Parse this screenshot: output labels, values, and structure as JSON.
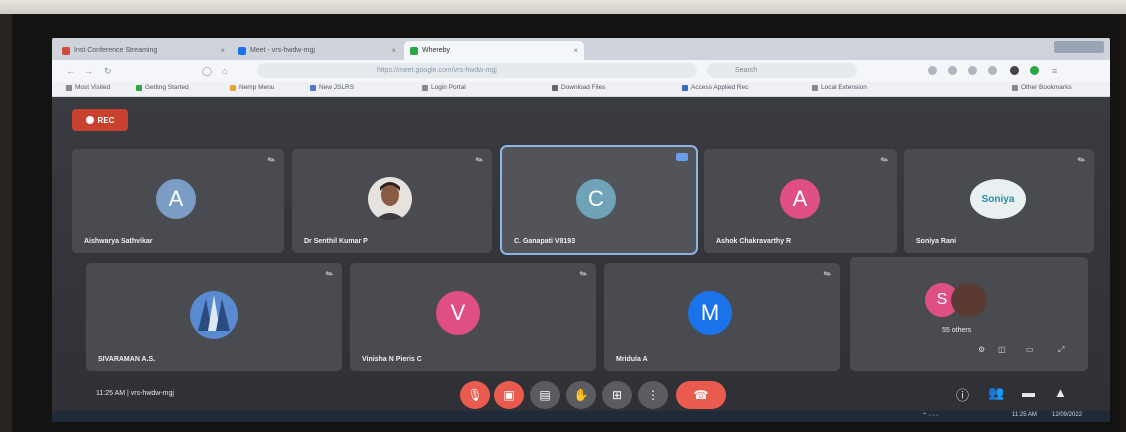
{
  "browser": {
    "tabs": [
      {
        "label": "Inst Conference Streaming",
        "active": false,
        "favicon": "#d24a3a"
      },
      {
        "label": "Meet - vrs-hwdw-mgj",
        "active": false,
        "favicon": "#1a73e8"
      },
      {
        "label": "Whereby",
        "active": true,
        "favicon": "#2aa548"
      }
    ],
    "url": "https://meet.google.com/vrs-hwdw-mgj",
    "search_placeholder": "Search",
    "bookmarks": [
      {
        "label": "Most Visited",
        "color": "#888"
      },
      {
        "label": "Getting Started",
        "color": "#2aa548"
      },
      {
        "label": "Nemp Menu",
        "color": "#e8a430"
      },
      {
        "label": "New JSLRS",
        "color": "#4a7ac8"
      },
      {
        "label": "Login Portal",
        "color": "#888"
      },
      {
        "label": "Download Files",
        "color": "#666"
      },
      {
        "label": "Access Applied Rec",
        "color": "#3a6ab8"
      },
      {
        "label": "Local Extension",
        "color": "#888"
      },
      {
        "label": "Other Bookmarks",
        "color": "#888"
      }
    ]
  },
  "meeting": {
    "recording_label": "REC",
    "participants_row1": [
      {
        "name": "Aishwarya Sathvikar",
        "initial": "A",
        "avatar_color": "#7b9cc4",
        "type": "initial"
      },
      {
        "name": "Dr Senthil Kumar P",
        "initial": "",
        "avatar_color": "#d8d2cc",
        "type": "photo"
      },
      {
        "name": "C. Ganapati V8193",
        "initial": "C",
        "avatar_color": "#6fa3b8",
        "type": "initial",
        "highlighted": true
      },
      {
        "name": "Ashok Chakravarthy R",
        "initial": "A",
        "avatar_color": "#e04e86",
        "type": "initial"
      },
      {
        "name": "Soniya Rani",
        "initial": "Soniya",
        "avatar_color": "#e8f0f2",
        "type": "logo"
      }
    ],
    "participants_row2": [
      {
        "name": "SIVARAMAN A.S.",
        "initial": "",
        "avatar_color": "#3a6ab8",
        "type": "image"
      },
      {
        "name": "Vinisha N Pieris C",
        "initial": "V",
        "avatar_color": "#e04e86",
        "type": "initial"
      },
      {
        "name": "Mridula A",
        "initial": "M",
        "avatar_color": "#1a73e8",
        "type": "initial"
      }
    ],
    "others_tile": {
      "initial": "S",
      "label": "55 others"
    },
    "clock_text": "11:25 AM | vrs-hwdw-mgj",
    "controls": [
      "mic-icon",
      "camera-icon",
      "captions-icon",
      "hand-icon",
      "present-icon",
      "more-icon",
      "end-call-icon"
    ]
  },
  "taskbar": {
    "time": "11:25 AM",
    "date": "12/09/2022"
  }
}
